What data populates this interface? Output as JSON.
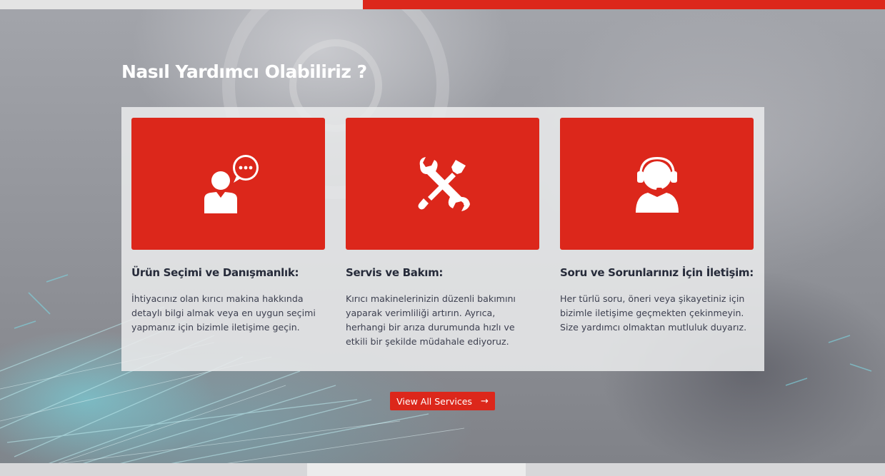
{
  "section": {
    "title": "Nasıl Yardımcı Olabiliriz ?"
  },
  "cards": [
    {
      "icon": "consultation-chat-icon",
      "title": "Ürün Seçimi ve Danışmanlık:",
      "text": "İhtiyacınız olan kırıcı makina hakkında detaylı bilgi almak veya en uygun seçimi yapmanız için bizimle iletişime geçin."
    },
    {
      "icon": "wrench-screwdriver-icon",
      "title": "Servis ve Bakım:",
      "text": "Kırıcı makinelerinizin düzenli bakımını yaparak verimliliği artırın. Ayrıca, herhangi bir arıza durumunda hızlı ve etkili bir şekilde müdahale ediyoruz."
    },
    {
      "icon": "headset-support-icon",
      "title": "Soru ve Sorunlarınız İçin İletişim:",
      "text": "Her türlü soru, öneri veya şikayetiniz için bizimle iletişime geçmekten çekinmeyin. Size yardımcı olmaktan mutluluk duyarız."
    }
  ],
  "cta": {
    "label": "View All Services",
    "arrow": "→"
  },
  "colors": {
    "accent": "#dc271b",
    "heading": "#262b3a",
    "body_text": "#3d4050"
  }
}
